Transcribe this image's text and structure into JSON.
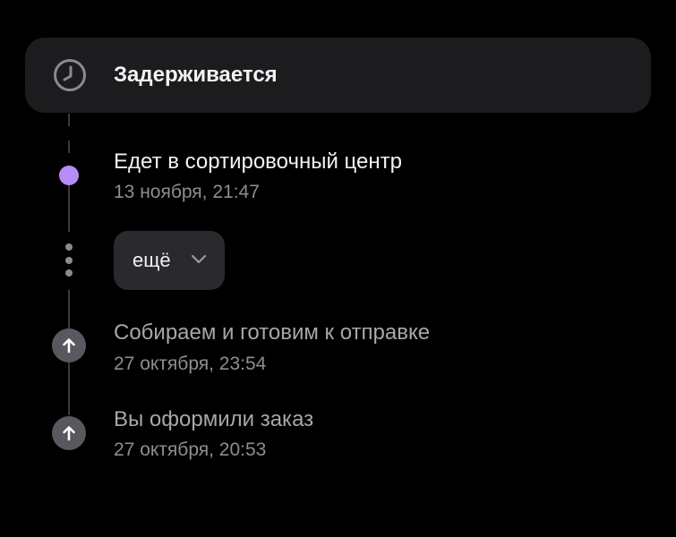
{
  "status": {
    "title": "Задерживается",
    "icon": "clock-icon"
  },
  "events": [
    {
      "title": "Едет в сортировочный центр",
      "date": "13 ноября, 21:47",
      "marker": "current-dot",
      "marker_color": "#b58df7"
    },
    {
      "title": "Собираем и готовим к отправке",
      "date": "27 октября, 23:54",
      "marker": "arrow-up-icon"
    },
    {
      "title": "Вы оформили заказ",
      "date": "27 октября, 20:53",
      "marker": "arrow-up-icon"
    }
  ],
  "more": {
    "label": "ещё",
    "icon": "chevron-down-icon"
  },
  "colors": {
    "background": "#000000",
    "card": "#1c1c1f",
    "accent": "#b58df7",
    "secondary_text": "#8d8d93"
  }
}
